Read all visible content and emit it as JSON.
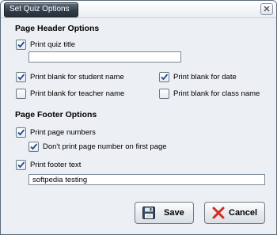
{
  "window": {
    "title": "Set Quiz Options"
  },
  "header_section": {
    "title": "Page Header Options",
    "print_quiz_title": {
      "label": "Print quiz title",
      "checked": true
    },
    "quiz_title_input": {
      "value": ""
    },
    "print_blank_student": {
      "label": "Print blank for student name",
      "checked": true
    },
    "print_blank_date": {
      "label": "Print blank for date",
      "checked": true
    },
    "print_blank_teacher": {
      "label": "Print blank for teacher name",
      "checked": false
    },
    "print_blank_class": {
      "label": "Print blank for class name",
      "checked": false
    }
  },
  "footer_section": {
    "title": "Page Footer Options",
    "print_page_numbers": {
      "label": "Print page numbers",
      "checked": true
    },
    "no_first_page_number": {
      "label": "Don't print page number on first page",
      "checked": true
    },
    "print_footer_text": {
      "label": "Print footer text",
      "checked": true
    },
    "footer_text_input": {
      "value": "softpedia testing"
    }
  },
  "buttons": {
    "save_label": "Save",
    "cancel_label": "Cancel"
  },
  "colors": {
    "check": "#1f4e8c",
    "cancel_x": "#d42a1e",
    "window_bg": "#eceff3",
    "title_tab": "#2f3a46"
  },
  "icons": {
    "save": "floppy-disk-icon",
    "cancel": "red-x-icon",
    "close": "close-icon"
  }
}
